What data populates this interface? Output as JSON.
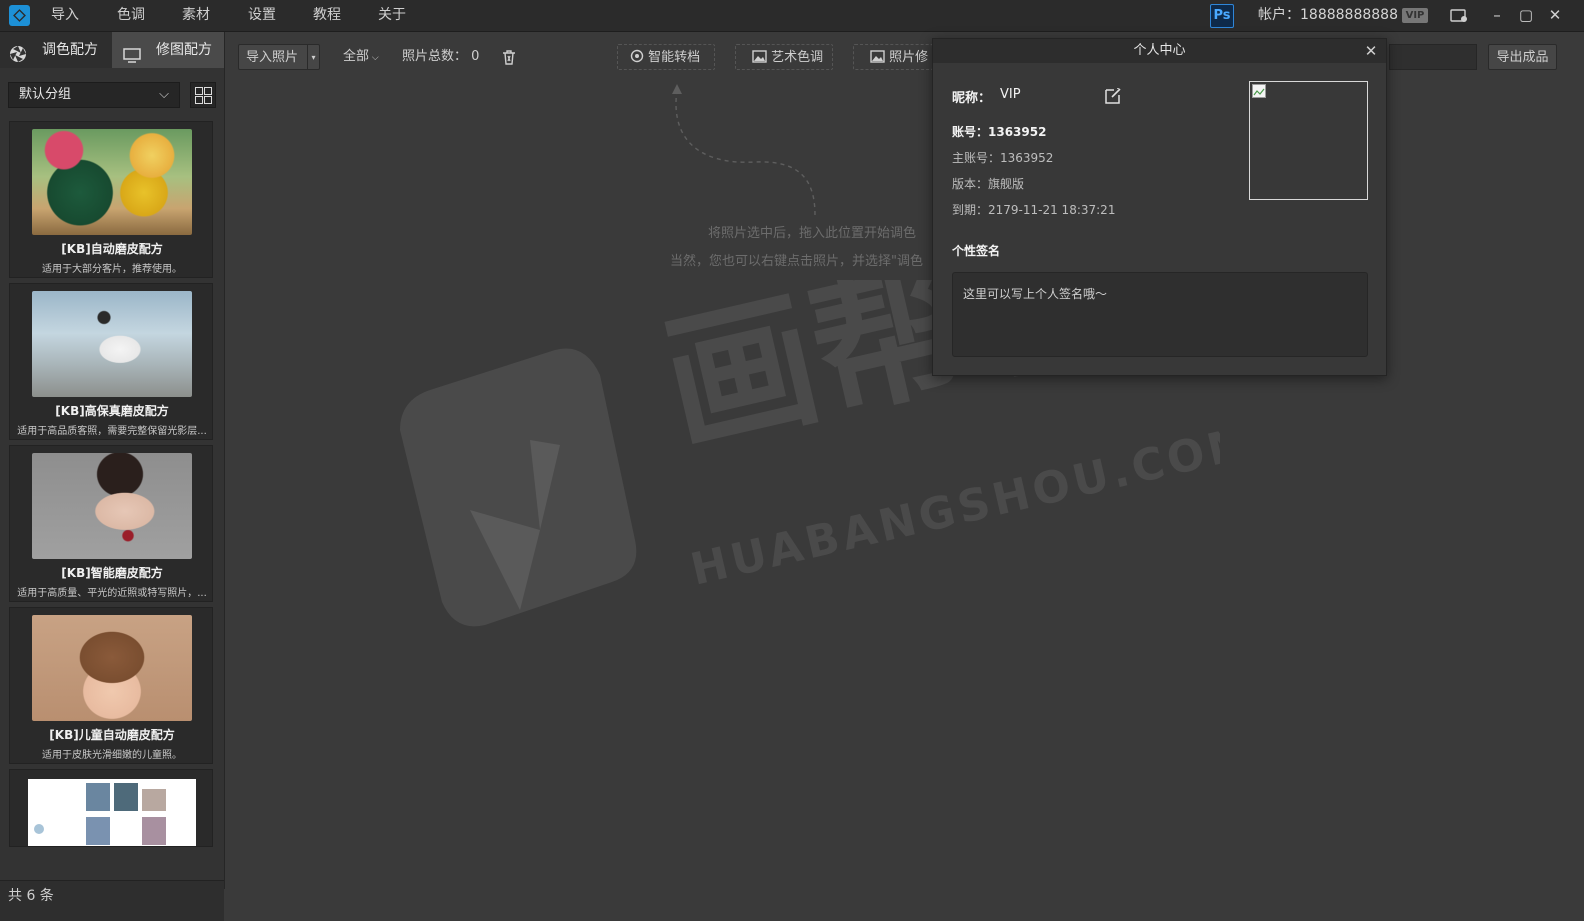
{
  "menu": [
    "导入",
    "色调",
    "素材",
    "设置",
    "教程",
    "关于"
  ],
  "title_bar": {
    "ps_label": "Ps",
    "account_label": "帐户：18888888888",
    "vip_badge": "VIP"
  },
  "sidebar": {
    "tabs": [
      {
        "label": "调色配方",
        "icon": "aperture-icon",
        "active": false
      },
      {
        "label": "修图配方",
        "icon": "monitor-icon",
        "active": true
      }
    ],
    "group_select": "默认分组",
    "cards": [
      {
        "title": "[KB]自动磨皮配方",
        "desc": "适用于大部分客片，推荐使用。"
      },
      {
        "title": "[KB]高保真磨皮配方",
        "desc": "适用于高品质客照，需要完整保留光影层..."
      },
      {
        "title": "[KB]智能磨皮配方",
        "desc": "适用于高质量、平光的近照或特写照片，..."
      },
      {
        "title": "[KB]儿童自动磨皮配方",
        "desc": "适用于皮肤光滑细嫩的儿童照。"
      }
    ],
    "footer": "共 6 条"
  },
  "toolbar": {
    "import_photos": "导入照片",
    "filter_all": "全部",
    "total_label": "照片总数：",
    "total_value": "0",
    "smart_convert": "智能转档",
    "art_tone": "艺术色调",
    "photo_retouch": "照片修",
    "export": "导出成品"
  },
  "hints": {
    "line1": "将照片选中后，拖入此位置开始调色",
    "line2": "当然，您也可以右键点击照片，并选择\"调色"
  },
  "dialog": {
    "title": "个人中心",
    "nickname_label": "昵称：",
    "nickname_value": "VIP",
    "account": "账号：1363952",
    "master_account": "主账号：1363952",
    "version": "版本：旗舰版",
    "expiry": "到期：2179-11-21 18:37:21",
    "signature_heading": "个性签名",
    "signature_placeholder": "这里可以写上个人签名哦～"
  },
  "watermark": {
    "text_cn": "画帮手",
    "text_en": "HUABANGSHOU.COM"
  },
  "colors": {
    "background": "#3a3a3a",
    "panel": "#333333",
    "ps_blue": "#2f86d8",
    "logo_blue": "#1d90d6"
  }
}
